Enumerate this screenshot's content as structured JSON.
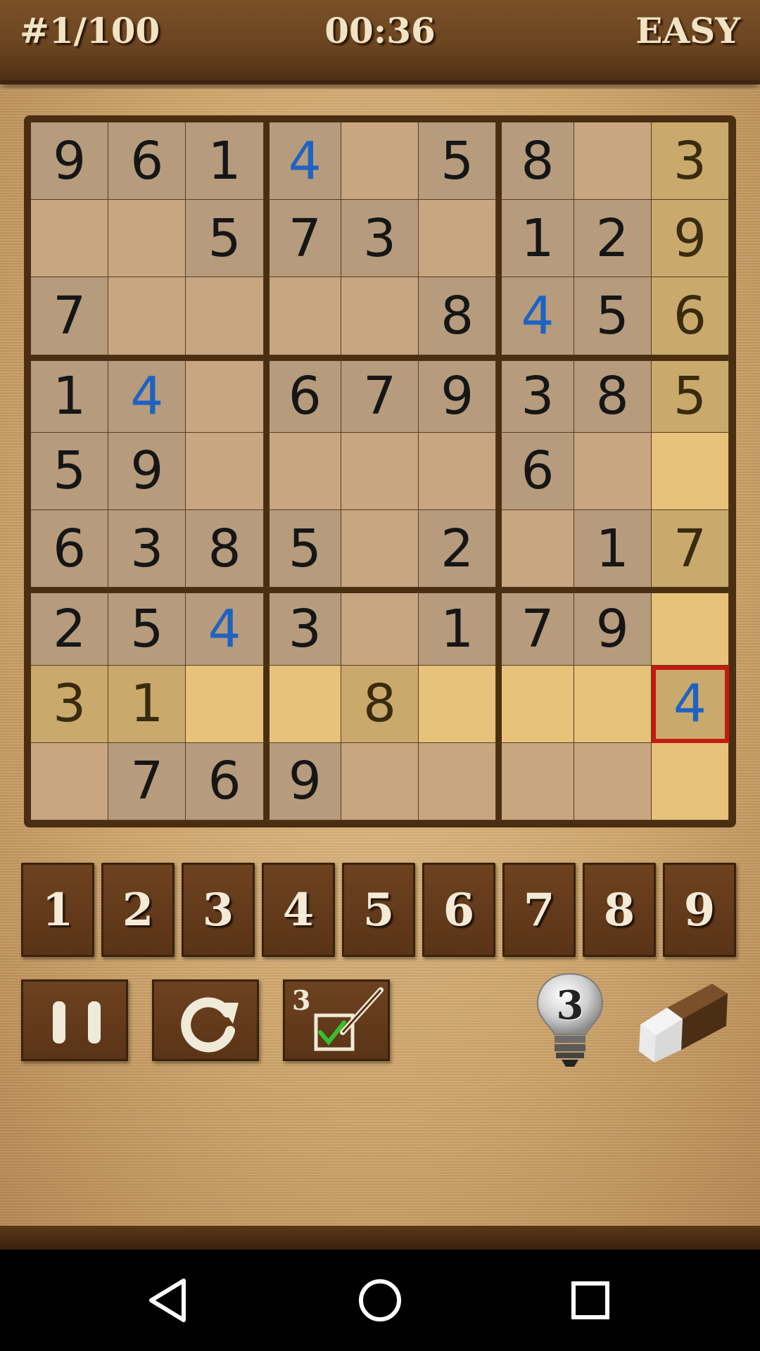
{
  "header": {
    "level": "#1/100",
    "timer": "00:36",
    "difficulty": "EASY"
  },
  "board": {
    "rows": [
      [
        "9",
        "6",
        "1",
        "4",
        "",
        "5",
        "8",
        "",
        "3"
      ],
      [
        "",
        "",
        "5",
        "7",
        "3",
        "",
        "1",
        "2",
        "9"
      ],
      [
        "7",
        "",
        "",
        "",
        "",
        "8",
        "4",
        "5",
        "6"
      ],
      [
        "1",
        "4",
        "",
        "6",
        "7",
        "9",
        "3",
        "8",
        "5"
      ],
      [
        "5",
        "9",
        "",
        "",
        "",
        "",
        "6",
        "",
        ""
      ],
      [
        "6",
        "3",
        "8",
        "5",
        "",
        "2",
        "",
        "1",
        "7"
      ],
      [
        "2",
        "5",
        "4",
        "3",
        "",
        "1",
        "7",
        "9",
        ""
      ],
      [
        "3",
        "1",
        "",
        "",
        "8",
        "",
        "",
        "",
        "4"
      ],
      [
        "",
        "7",
        "6",
        "9",
        "",
        "",
        "",
        "",
        ""
      ]
    ],
    "user_entries": [
      [
        0,
        3
      ],
      [
        2,
        6
      ],
      [
        3,
        1
      ],
      [
        6,
        2
      ],
      [
        7,
        8
      ]
    ],
    "selected": [
      7,
      8
    ],
    "highlight_row": 7,
    "highlight_col": 8
  },
  "numpad": [
    "1",
    "2",
    "3",
    "4",
    "5",
    "6",
    "7",
    "8",
    "9"
  ],
  "tools": {
    "notes_count": "3",
    "hint_count": "3"
  },
  "colors": {
    "user_digit": "#1f63c2",
    "selected_border": "#c51a12",
    "wood": "#5a3417"
  }
}
